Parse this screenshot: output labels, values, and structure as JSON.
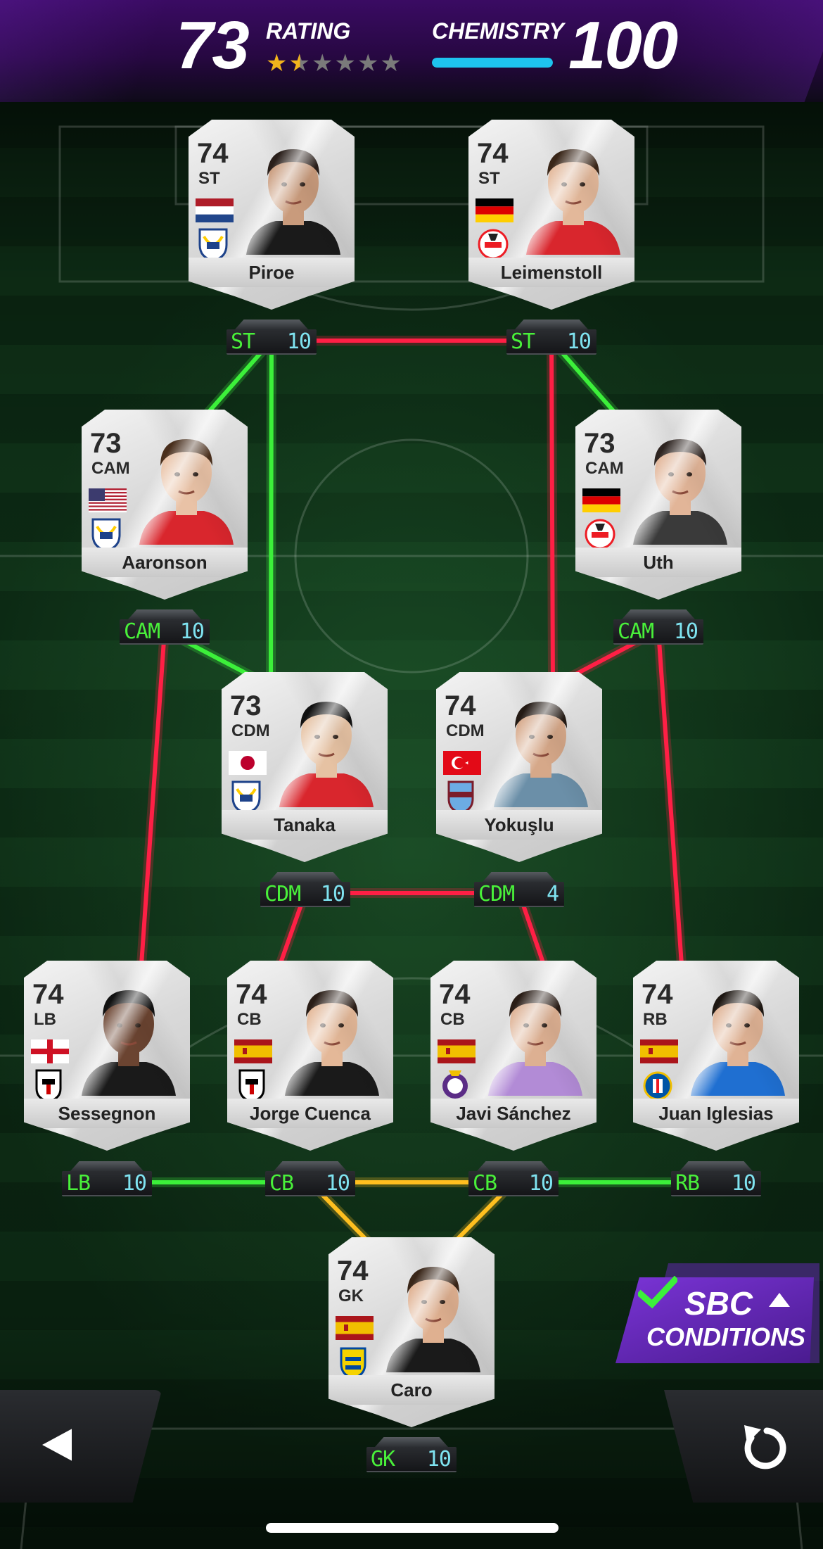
{
  "header": {
    "rating_value": "73",
    "rating_label": "RATING",
    "rating_stars": 1.5,
    "rating_stars_max": 6,
    "chemistry_label": "CHEMISTRY",
    "chemistry_value": "100",
    "chemistry_fill": 1.0
  },
  "colors": {
    "link_green": "#3cf03a",
    "link_red": "#ff1f45",
    "link_yellow": "#ffbf1f",
    "position_text": "#49f03a",
    "chem_text": "#7fe3f0",
    "header_purple": "#3a0b63",
    "chem_bar": "#1ec3ef",
    "sbc_purple": "#6a2bc4"
  },
  "players": [
    {
      "id": "piroe",
      "name": "Piroe",
      "rating": "74",
      "card_position": "ST",
      "slot_position": "ST",
      "chemistry": "10",
      "flag": "netherlands",
      "club": "leeds-united",
      "skin": "#c99b7c",
      "hair": "#2a1f1a",
      "shirt": "#1a1a1a"
    },
    {
      "id": "leimenstoll",
      "name": "Leimenstoll",
      "rating": "74",
      "card_position": "ST",
      "slot_position": "ST",
      "chemistry": "10",
      "flag": "germany",
      "club": "fc-koln",
      "skin": "#e3b89a",
      "hair": "#3a2618",
      "shirt": "#d9262d"
    },
    {
      "id": "aaronson",
      "name": "Aaronson",
      "rating": "73",
      "card_position": "CAM",
      "slot_position": "CAM",
      "chemistry": "10",
      "flag": "usa",
      "club": "leeds-united",
      "skin": "#e9c2a6",
      "hair": "#4a2f1c",
      "shirt": "#d9262d"
    },
    {
      "id": "uth",
      "name": "Uth",
      "rating": "73",
      "card_position": "CAM",
      "slot_position": "CAM",
      "chemistry": "10",
      "flag": "germany",
      "club": "fc-koln",
      "skin": "#e2b598",
      "hair": "#2e2420",
      "shirt": "#3a3a3a"
    },
    {
      "id": "tanaka",
      "name": "Tanaka",
      "rating": "73",
      "card_position": "CDM",
      "slot_position": "CDM",
      "chemistry": "10",
      "flag": "japan",
      "club": "leeds-united",
      "skin": "#e6c2a3",
      "hair": "#111111",
      "shirt": "#d9262d"
    },
    {
      "id": "yokuslu",
      "name": "Yokuşlu",
      "rating": "74",
      "card_position": "CDM",
      "slot_position": "CDM",
      "chemistry": "4",
      "flag": "turkey",
      "club": "trabzonspor",
      "skin": "#d6a889",
      "hair": "#241a14",
      "shirt": "#6b8fa8"
    },
    {
      "id": "sessegnon",
      "name": "Sessegnon",
      "rating": "74",
      "card_position": "LB",
      "slot_position": "LB",
      "chemistry": "10",
      "flag": "england",
      "club": "fulham",
      "skin": "#6b4431",
      "hair": "#111111",
      "shirt": "#1a1a1a"
    },
    {
      "id": "jorge-cuenca",
      "name": "Jorge Cuenca",
      "rating": "74",
      "card_position": "CB",
      "slot_position": "CB",
      "chemistry": "10",
      "flag": "spain",
      "club": "fulham",
      "skin": "#e4b898",
      "hair": "#2a1d16",
      "shirt": "#1a1a1a"
    },
    {
      "id": "javi-sanchez",
      "name": "Javi Sánchez",
      "rating": "74",
      "card_position": "CB",
      "slot_position": "CB",
      "chemistry": "10",
      "flag": "spain",
      "club": "real-valladolid",
      "skin": "#ddb092",
      "hair": "#2a1d16",
      "shirt": "#b28bd6"
    },
    {
      "id": "juan-iglesias",
      "name": "Juan Iglesias",
      "rating": "74",
      "card_position": "RB",
      "slot_position": "RB",
      "chemistry": "10",
      "flag": "spain",
      "club": "getafe",
      "skin": "#e0b395",
      "hair": "#1e1712",
      "shirt": "#1f6fd1"
    },
    {
      "id": "caro",
      "name": "Caro",
      "rating": "74",
      "card_position": "GK",
      "slot_position": "GK",
      "chemistry": "10",
      "flag": "spain",
      "club": "cadiz",
      "skin": "#dfb090",
      "hair": "#3a2618",
      "shirt": "#1a1a1a"
    }
  ],
  "links": [
    {
      "from": "piroe",
      "to": "leimenstoll",
      "color": "red"
    },
    {
      "from": "piroe",
      "to": "aaronson",
      "color": "green"
    },
    {
      "from": "piroe",
      "to": "tanaka",
      "color": "green"
    },
    {
      "from": "leimenstoll",
      "to": "uth",
      "color": "green"
    },
    {
      "from": "leimenstoll",
      "to": "yokuslu",
      "color": "red"
    },
    {
      "from": "aaronson",
      "to": "tanaka",
      "color": "green"
    },
    {
      "from": "aaronson",
      "to": "sessegnon",
      "color": "red"
    },
    {
      "from": "uth",
      "to": "yokuslu",
      "color": "red"
    },
    {
      "from": "uth",
      "to": "juan-iglesias",
      "color": "red"
    },
    {
      "from": "tanaka",
      "to": "yokuslu",
      "color": "red"
    },
    {
      "from": "tanaka",
      "to": "jorge-cuenca",
      "color": "red"
    },
    {
      "from": "yokuslu",
      "to": "javi-sanchez",
      "color": "red"
    },
    {
      "from": "sessegnon",
      "to": "jorge-cuenca",
      "color": "green"
    },
    {
      "from": "jorge-cuenca",
      "to": "javi-sanchez",
      "color": "yellow"
    },
    {
      "from": "javi-sanchez",
      "to": "juan-iglesias",
      "color": "green"
    },
    {
      "from": "jorge-cuenca",
      "to": "caro",
      "color": "yellow"
    },
    {
      "from": "javi-sanchez",
      "to": "caro",
      "color": "yellow"
    }
  ],
  "sbc": {
    "line1": "SBC",
    "line2": "CONDITIONS",
    "check_icon": "checkmark-icon",
    "caret_icon": "caret-up-icon"
  },
  "nav": {
    "back_icon": "back-triangle-icon",
    "reset_icon": "reset-arrow-icon"
  }
}
